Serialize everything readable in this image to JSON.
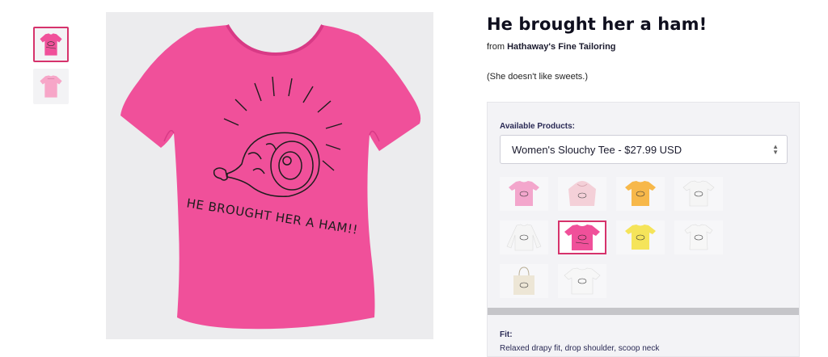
{
  "product": {
    "title": "He brought her a ham!",
    "by_prefix": "from",
    "shop_name": "Hathaway's Fine Tailoring",
    "description": "(She doesn't like sweets.)",
    "shirt_print_text": "HE BROUGHT HER A HAM!!",
    "main_color": "#f0509a"
  },
  "thumbnails": [
    {
      "name": "front-view",
      "color": "#f0509a",
      "selected": true
    },
    {
      "name": "back-view",
      "color": "#f7a6c8",
      "selected": false
    }
  ],
  "panel": {
    "available_label": "Available Products:",
    "selected_product": "Women's Slouchy Tee - $27.99 USD",
    "fit_label": "Fit:",
    "fit_text": "Relaxed drapy fit, drop shoulder, scoop neck"
  },
  "product_options": [
    {
      "name": "pink-tee",
      "type": "tee",
      "color": "#f3a6cc",
      "selected": false
    },
    {
      "name": "light-pink-hoodie",
      "type": "hoodie",
      "color": "#f4d0d8",
      "selected": false
    },
    {
      "name": "orange-tee",
      "type": "tee",
      "color": "#f7b84a",
      "selected": false
    },
    {
      "name": "white-tee",
      "type": "tee",
      "color": "#f5f5f5",
      "selected": false
    },
    {
      "name": "white-longsleeve",
      "type": "longsleeve",
      "color": "#f5f5f5",
      "selected": false
    },
    {
      "name": "hot-pink-slouchy-tee",
      "type": "slouchy",
      "color": "#f0509a",
      "selected": true
    },
    {
      "name": "yellow-tee",
      "type": "tee",
      "color": "#f5e45a",
      "selected": false
    },
    {
      "name": "white-womens-tee",
      "type": "tee",
      "color": "#f7f7f7",
      "selected": false
    },
    {
      "name": "natural-tote-bag",
      "type": "tote",
      "color": "#ede6d6",
      "selected": false
    },
    {
      "name": "white-slouchy-tee",
      "type": "slouchy",
      "color": "#f7f7f7",
      "selected": false
    }
  ]
}
